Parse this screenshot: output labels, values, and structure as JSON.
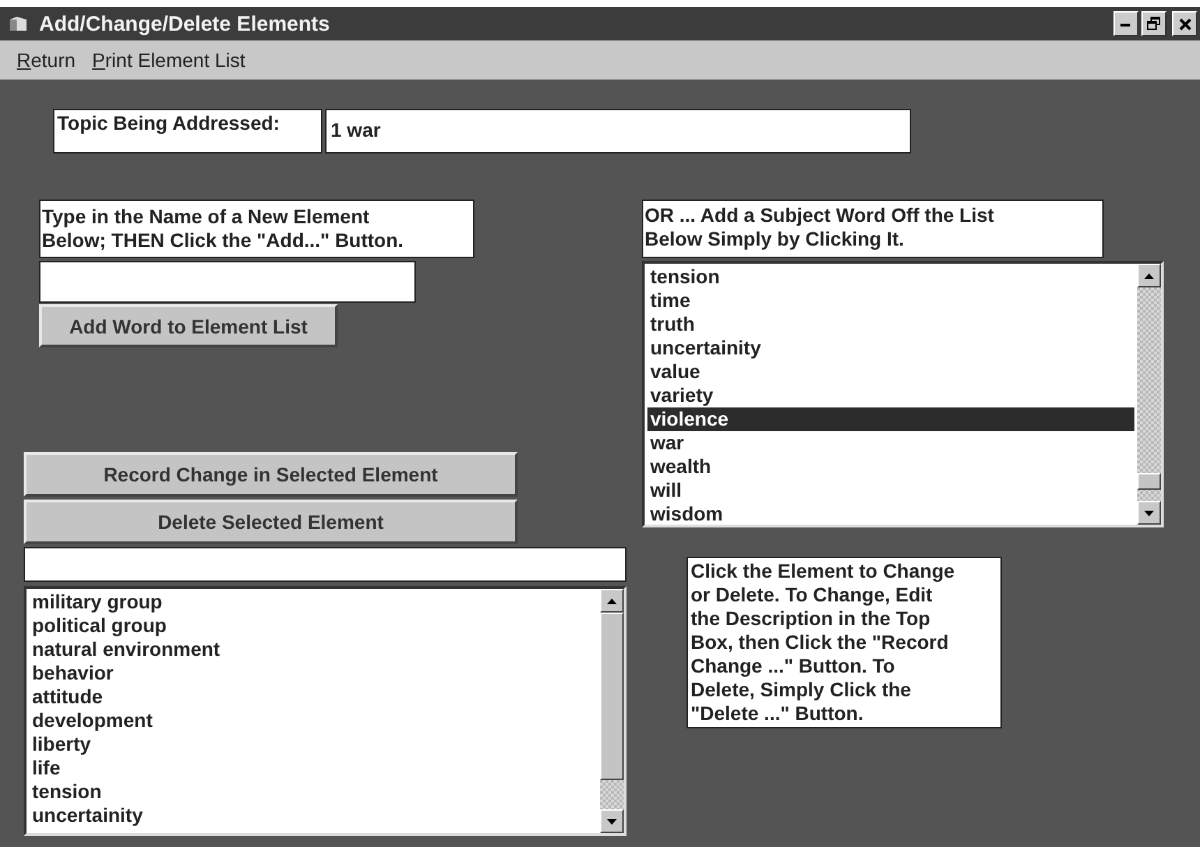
{
  "window": {
    "title": "Add/Change/Delete Elements"
  },
  "menu": [
    {
      "label": "Return"
    },
    {
      "label": "Print Element List"
    }
  ],
  "topic": {
    "label": "Topic Being Addressed:",
    "value": "1 war"
  },
  "new_element": {
    "instructions": "Type in the Name of a New Element\nBelow; THEN Click the \"Add...\" Button.",
    "button": "Add Word to Element List"
  },
  "subject_words": {
    "instructions": "OR ... Add a Subject Word Off the List\nBelow Simply by Clicking It.",
    "items": [
      {
        "label": "tension",
        "selected": false
      },
      {
        "label": "time",
        "selected": false
      },
      {
        "label": "truth",
        "selected": false
      },
      {
        "label": "uncertainity",
        "selected": false
      },
      {
        "label": "value",
        "selected": false
      },
      {
        "label": "variety",
        "selected": false
      },
      {
        "label": "violence",
        "selected": true
      },
      {
        "label": "war",
        "selected": false
      },
      {
        "label": "wealth",
        "selected": false
      },
      {
        "label": "will",
        "selected": false
      },
      {
        "label": "wisdom",
        "selected": false
      }
    ]
  },
  "edit": {
    "record_button": "Record Change in Selected Element",
    "delete_button": "Delete Selected Element"
  },
  "elements": [
    {
      "label": "military group",
      "selected": false
    },
    {
      "label": "political group",
      "selected": false
    },
    {
      "label": "natural environment",
      "selected": false
    },
    {
      "label": "behavior",
      "selected": false
    },
    {
      "label": "attitude",
      "selected": false
    },
    {
      "label": "development",
      "selected": false
    },
    {
      "label": "liberty",
      "selected": false
    },
    {
      "label": "life",
      "selected": false
    },
    {
      "label": "tension",
      "selected": false
    },
    {
      "label": "uncertainity",
      "selected": false
    }
  ],
  "help": "Click the Element to Change\nor Delete. To Change, Edit\nthe Description in the Top\nBox, then Click  the \"Record\nChange ...\" Button. To\nDelete, Simply Click the\n\"Delete ...\" Button."
}
